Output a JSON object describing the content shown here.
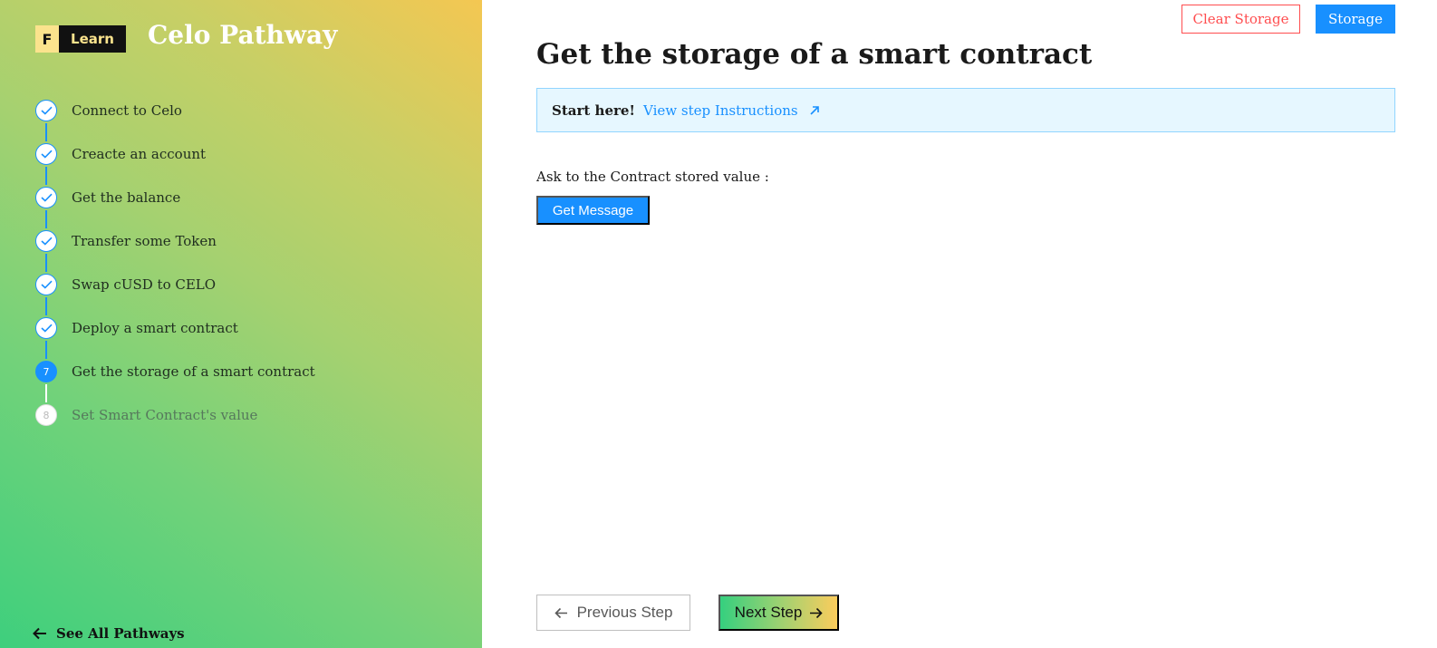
{
  "sidebar": {
    "logo_letter": "F",
    "logo_text": "Learn",
    "title": "Celo Pathway",
    "steps": [
      {
        "label": "Connect to Celo",
        "number": "1",
        "status": "done"
      },
      {
        "label": "Creacte an account",
        "number": "2",
        "status": "done"
      },
      {
        "label": "Get the balance",
        "number": "3",
        "status": "done"
      },
      {
        "label": "Transfer some Token",
        "number": "4",
        "status": "done"
      },
      {
        "label": "Swap cUSD to CELO",
        "number": "5",
        "status": "done"
      },
      {
        "label": "Deploy a smart contract",
        "number": "6",
        "status": "done"
      },
      {
        "label": "Get the storage of a smart contract",
        "number": "7",
        "status": "current"
      },
      {
        "label": "Set Smart Contract's value",
        "number": "8",
        "status": "pending"
      }
    ],
    "see_all": "See All Pathways"
  },
  "header": {
    "clear_storage": "Clear Storage",
    "storage": "Storage"
  },
  "main": {
    "title": "Get the storage of a smart contract",
    "info": {
      "strong": "Start here!",
      "link": "View step Instructions"
    },
    "ask_label": "Ask to the Contract stored value :",
    "get_message": "Get Message"
  },
  "footer": {
    "previous": "Previous Step",
    "next": "Next Step"
  },
  "colors": {
    "accent": "#1890ff",
    "danger": "#ff4d4f",
    "info_bg": "#e6f7ff",
    "gradient_green": "#35d07f",
    "gradient_yellow": "#fbcc5c"
  },
  "icons": {
    "step_done": "check-icon",
    "see_all": "arrow-left-icon",
    "info_link": "arrow-up-right-icon",
    "previous": "arrow-left-icon",
    "next": "arrow-right-icon"
  }
}
